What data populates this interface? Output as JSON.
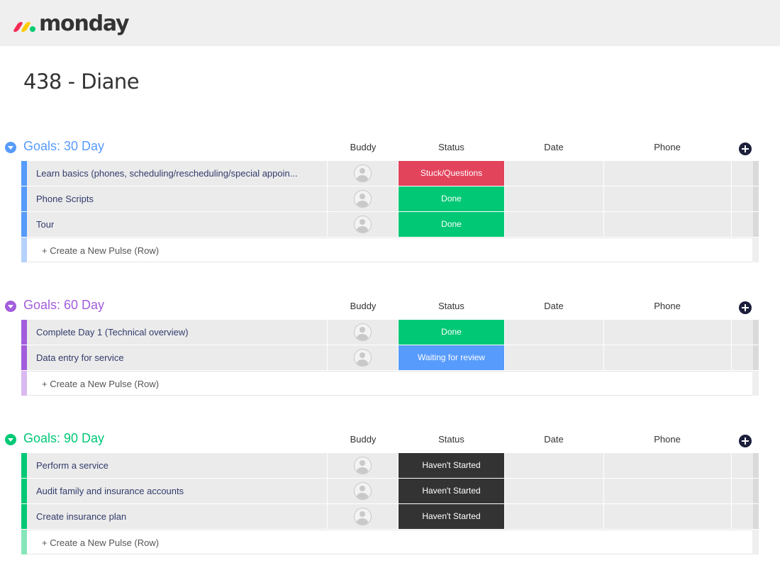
{
  "app": {
    "brand": "monday",
    "brand_colors": [
      "#f62b54",
      "#ffcb00",
      "#00ca72"
    ]
  },
  "board": {
    "title": "438 - Diane"
  },
  "columns": {
    "buddy": "Buddy",
    "status": "Status",
    "date": "Date",
    "phone": "Phone"
  },
  "create_label": "+ Create a New Pulse (Row)",
  "status_colors": {
    "Stuck/Questions": "#e2445c",
    "Done": "#00c875",
    "Waiting for review": "#579bfc",
    "Haven't Started": "#333333"
  },
  "groups": [
    {
      "title": "Goals: 30 Day",
      "color": "#579bfc",
      "light_color": "#b4d2fb",
      "rows": [
        {
          "name": "Learn basics (phones, scheduling/rescheduling/special appoin...",
          "status": "Stuck/Questions"
        },
        {
          "name": "Phone Scripts",
          "status": "Done"
        },
        {
          "name": "Tour",
          "status": "Done"
        }
      ]
    },
    {
      "title": "Goals: 60 Day",
      "color": "#a25ddc",
      "light_color": "#d9b9f1",
      "rows": [
        {
          "name": "Complete Day 1 (Technical overview)",
          "status": "Done"
        },
        {
          "name": "Data entry for service",
          "status": "Waiting for review"
        }
      ]
    },
    {
      "title": "Goals: 90 Day",
      "color": "#00c875",
      "light_color": "#86e5bb",
      "rows": [
        {
          "name": "Perform a service",
          "status": "Haven't Started"
        },
        {
          "name": "Audit family and insurance accounts",
          "status": "Haven't Started"
        },
        {
          "name": "Create insurance plan",
          "status": "Haven't Started"
        }
      ]
    }
  ]
}
